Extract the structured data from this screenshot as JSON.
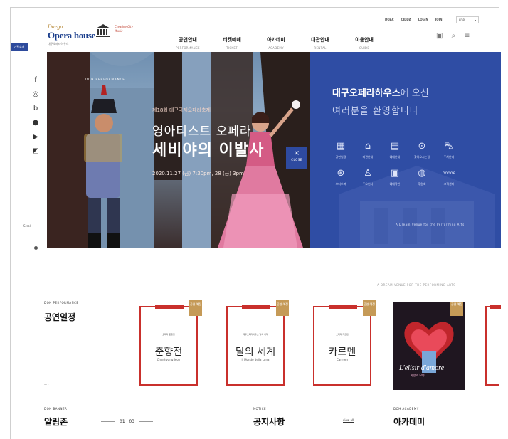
{
  "header": {
    "logo_line1": "Daegu",
    "logo_line2": "Opera house",
    "logo_line3": "대구오페라하우스",
    "partner_text": "Creative City Music",
    "nav": [
      {
        "ko": "공연안내",
        "en": "PERFORMANCE"
      },
      {
        "ko": "티켓예매",
        "en": "TICKET"
      },
      {
        "ko": "아카데미",
        "en": "ACADEMY"
      },
      {
        "ko": "대관안내",
        "en": "RENTAL"
      },
      {
        "ko": "이용안내",
        "en": "GUIDE"
      }
    ],
    "util": [
      "DOAC",
      "CIDDA",
      "LOGIN",
      "JOIN"
    ],
    "lang": "KOR",
    "side_badge": "기관소개"
  },
  "sidebar": {
    "scroll_label": "Scroll"
  },
  "hero": {
    "kicker": "DOH PERFORMANCE",
    "festival": "제18회 대구국제오페라축제",
    "title1": "영아티스트 오페라",
    "title2": "세비야의 이발사",
    "date": "2020.11.27 (금) 7:30pm, 28 (금) 3pm",
    "close_label": "CLOSE"
  },
  "welcome": {
    "line1_bold": "대구오페라하우스",
    "line1_rest": "에 오신",
    "line2": "여러분을 환영합니다",
    "quick": [
      {
        "icon": "calendar",
        "label": "공연일정"
      },
      {
        "icon": "building",
        "label": "대관안내"
      },
      {
        "icon": "ticket",
        "label": "예매안내"
      },
      {
        "icon": "map",
        "label": "찾아오시는길"
      },
      {
        "icon": "car",
        "label": "주차안내"
      },
      {
        "icon": "coupon",
        "label": "오디오북"
      },
      {
        "icon": "seat",
        "label": "주요인사"
      },
      {
        "icon": "book",
        "label": "예매확인"
      },
      {
        "icon": "globe",
        "label": "후원회"
      },
      {
        "icon": "more",
        "label": "고객센터"
      }
    ],
    "quick_more": "ooooe",
    "slogan": "A Dream Venue for the Performing Arts"
  },
  "performance": {
    "kicker": "DOH PERFORMANCE",
    "title": "공연일정",
    "dash": "— ·",
    "banner_caption": "A DREAM VENUE FOR THE PERFORMING ARTS",
    "cards": [
      {
        "sub": "오페라 춘향전",
        "main": "춘향전",
        "eng": "Chunhyang Jeon",
        "ribbon": "공연 예정"
      },
      {
        "sub": "대구오페라하우스 달의 세계",
        "main": "달의 세계",
        "eng": "Il Mondo della Luna",
        "ribbon": "공연 예정"
      },
      {
        "sub": "오페라 카르멘",
        "main": "카르멘",
        "eng": "Carmen",
        "ribbon": "공연 예정"
      },
      {
        "photo_title": "L'elisir d'amore",
        "photo_sub": "사랑의 묘약",
        "ribbon": "공연 예정"
      }
    ]
  },
  "bottom": {
    "banner_kicker": "DOH BANNER",
    "banner_title": "알림존",
    "pager": "01 · 03",
    "notice_kicker": "NOTICE",
    "notice_title": "공지사항",
    "view_all": "view all",
    "academy_kicker": "DOH ACADEMY",
    "academy_title": "아카데미"
  },
  "colors": {
    "brand_blue": "#2f4da4",
    "accent_red": "#c9302c",
    "ribbon_gold": "#c59a57"
  }
}
